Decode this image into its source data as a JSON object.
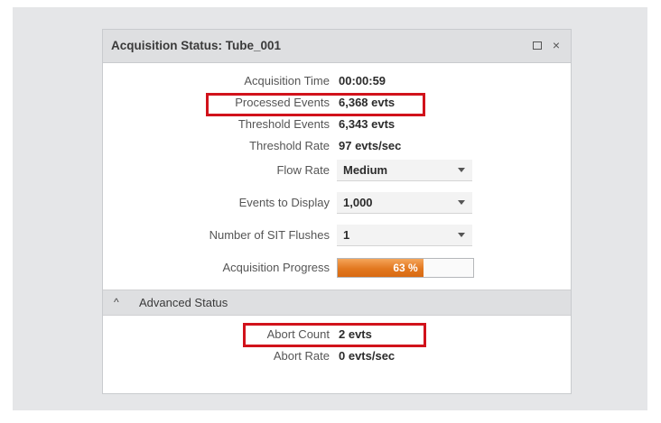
{
  "window": {
    "title": "Acquisition Status: Tube_001",
    "maximize_icon": "maximize-icon",
    "close_icon": "close-icon",
    "close_glyph": "×"
  },
  "status": {
    "acquisition_time": {
      "label": "Acquisition Time",
      "value": "00:00:59"
    },
    "processed_events": {
      "label": "Processed Events",
      "value": "6,368  evts"
    },
    "threshold_events": {
      "label": "Threshold Events",
      "value": "6,343  evts"
    },
    "threshold_rate": {
      "label": "Threshold Rate",
      "value": "97  evts/sec"
    },
    "flow_rate": {
      "label": "Flow Rate",
      "selected": "Medium"
    },
    "events_to_display": {
      "label": "Events to Display",
      "selected": "1,000"
    },
    "sit_flushes": {
      "label": "Number of SIT Flushes",
      "selected": "1"
    },
    "acquisition_progress": {
      "label": "Acquisition Progress",
      "percent": 63,
      "text": "63 %"
    }
  },
  "advanced": {
    "header_label": "Advanced Status",
    "chevron_icon": "chevron-up-icon",
    "chevron_glyph": "^",
    "abort_count": {
      "label": "Abort Count",
      "value": "2  evts"
    },
    "abort_rate": {
      "label": "Abort Rate",
      "value": "0  evts/sec"
    }
  },
  "colors": {
    "highlight": "#d1121b",
    "progress_fill": "#e2781f"
  }
}
